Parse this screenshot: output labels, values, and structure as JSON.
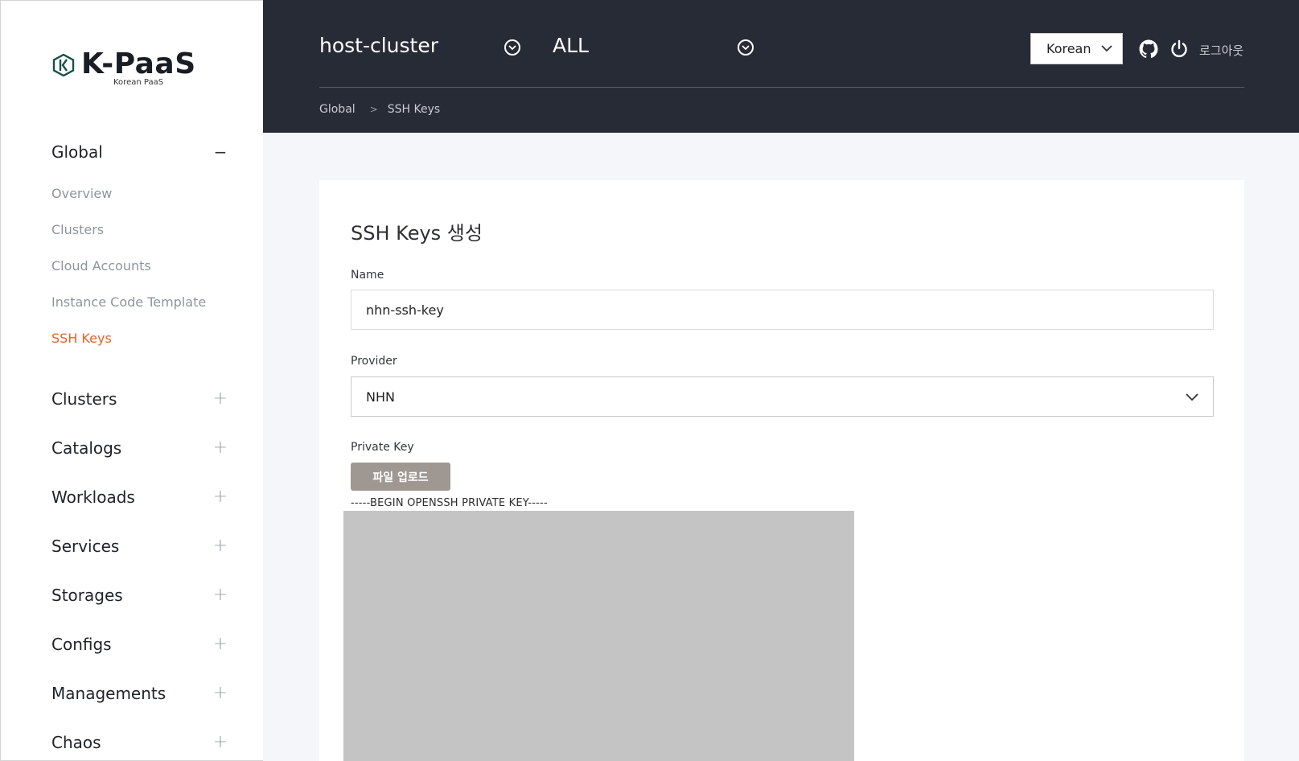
{
  "brand": {
    "name": "K-PaaS",
    "subtitle": "Korean PaaS",
    "color": "#1a1d24"
  },
  "sidebar": {
    "global": {
      "title": "Global",
      "toggle": "−",
      "items": [
        {
          "label": "Overview"
        },
        {
          "label": "Clusters"
        },
        {
          "label": "Cloud Accounts"
        },
        {
          "label": "Instance Code Template"
        },
        {
          "label": "SSH Keys",
          "active": true
        }
      ]
    },
    "groups": [
      {
        "label": "Clusters",
        "toggle": "+"
      },
      {
        "label": "Catalogs",
        "toggle": "+"
      },
      {
        "label": "Workloads",
        "toggle": "+"
      },
      {
        "label": "Services",
        "toggle": "+"
      },
      {
        "label": "Storages",
        "toggle": "+"
      },
      {
        "label": "Configs",
        "toggle": "+"
      },
      {
        "label": "Managements",
        "toggle": "+"
      },
      {
        "label": "Chaos",
        "toggle": "+"
      }
    ],
    "active_color": "#e8602a"
  },
  "header": {
    "cluster": "host-cluster",
    "namespace": "ALL",
    "language": "Korean",
    "logout": "로그아웃",
    "icons": [
      "chevron-down-circle-icon",
      "github-icon",
      "power-icon"
    ],
    "breadcrumb": [
      "Global",
      "SSH Keys"
    ],
    "bg_color": "#272b36"
  },
  "form": {
    "title": "SSH Keys 생성",
    "name_label": "Name",
    "name_value": "nhn-ssh-key",
    "provider_label": "Provider",
    "provider_value": "NHN",
    "private_key_label": "Private Key",
    "upload_button": "파일 업로드",
    "key_begin": "-----BEGIN OPENSSH PRIVATE KEY-----"
  }
}
